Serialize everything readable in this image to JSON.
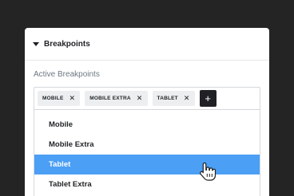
{
  "section": {
    "title": "Breakpoints",
    "caret_icon": "caret-down-icon"
  },
  "field": {
    "label": "Active Breakpoints"
  },
  "tags": [
    {
      "label": "MOBILE",
      "remove": "✕"
    },
    {
      "label": "MOBILE EXTRA",
      "remove": "✕"
    },
    {
      "label": "TABLET",
      "remove": "✕"
    }
  ],
  "add_button": {
    "label": "+"
  },
  "options": [
    {
      "label": "Mobile",
      "selected": false
    },
    {
      "label": "Mobile Extra",
      "selected": false
    },
    {
      "label": "Tablet",
      "selected": true
    },
    {
      "label": "Tablet Extra",
      "selected": false
    }
  ],
  "colors": {
    "background": "#242424",
    "panel": "#ffffff",
    "selected": "#4b9ff4",
    "tag": "#eceef0",
    "add_button": "#1f2124"
  }
}
